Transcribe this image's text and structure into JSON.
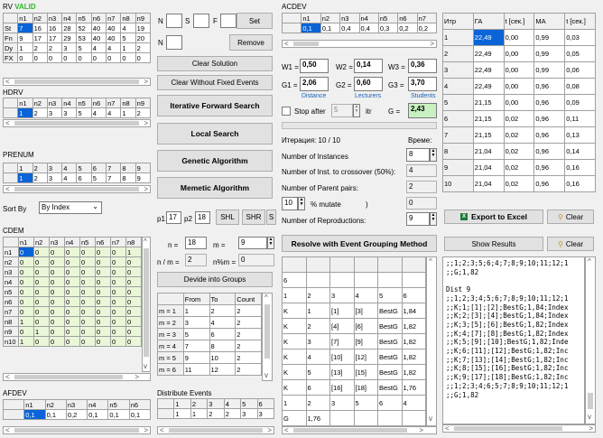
{
  "rv": {
    "title": "RV",
    "status": "VALID",
    "cols": [
      "",
      "n1",
      "n2",
      "n3",
      "n4",
      "n5",
      "n6",
      "n7",
      "n8",
      "n9"
    ],
    "rows": [
      [
        "St",
        "7",
        "16",
        "16",
        "28",
        "52",
        "40",
        "40",
        "4",
        "19"
      ],
      [
        "Fn",
        "9",
        "17",
        "17",
        "29",
        "53",
        "40",
        "40",
        "5",
        "20"
      ],
      [
        "Dy",
        "1",
        "2",
        "2",
        "3",
        "5",
        "4",
        "4",
        "1",
        "2"
      ],
      [
        "FX",
        "0",
        "0",
        "0",
        "0",
        "0",
        "0",
        "0",
        "0",
        "0"
      ]
    ]
  },
  "hdrv": {
    "title": "HDRV",
    "cols": [
      "",
      "n1",
      "n2",
      "n3",
      "n4",
      "n5",
      "n6",
      "n7",
      "n8",
      "n9"
    ],
    "row": [
      "",
      "1",
      "2",
      "3",
      "3",
      "5",
      "4",
      "4",
      "1",
      "2"
    ]
  },
  "prenum": {
    "title": "PRENUM",
    "r1": [
      "",
      "1",
      "2",
      "3",
      "4",
      "5",
      "6",
      "7",
      "8",
      "9"
    ],
    "r2": [
      "",
      "1",
      "2",
      "3",
      "4",
      "6",
      "5",
      "7",
      "8",
      "9"
    ]
  },
  "sort": {
    "label": "Sort By",
    "value": "By Index"
  },
  "cdem": {
    "title": "CDEM",
    "cols": [
      "",
      "n1",
      "n2",
      "n3",
      "n4",
      "n5",
      "n6",
      "n7",
      "n8"
    ],
    "rows": [
      [
        "n1",
        "0",
        "0",
        "0",
        "0",
        "0",
        "0",
        "0",
        "1"
      ],
      [
        "n2",
        "0",
        "0",
        "0",
        "0",
        "0",
        "0",
        "0",
        "0"
      ],
      [
        "n3",
        "0",
        "0",
        "0",
        "0",
        "0",
        "0",
        "0",
        "0"
      ],
      [
        "n4",
        "0",
        "0",
        "0",
        "0",
        "0",
        "0",
        "0",
        "0"
      ],
      [
        "n5",
        "0",
        "0",
        "0",
        "0",
        "0",
        "0",
        "0",
        "0"
      ],
      [
        "n6",
        "0",
        "0",
        "0",
        "0",
        "0",
        "0",
        "0",
        "0"
      ],
      [
        "n7",
        "0",
        "0",
        "0",
        "0",
        "0",
        "0",
        "0",
        "0"
      ],
      [
        "n8",
        "1",
        "0",
        "0",
        "0",
        "0",
        "0",
        "0",
        "0"
      ],
      [
        "n9",
        "0",
        "1",
        "0",
        "0",
        "0",
        "0",
        "0",
        "0"
      ],
      [
        "n10",
        "1",
        "0",
        "0",
        "0",
        "0",
        "0",
        "0",
        "0"
      ]
    ]
  },
  "afdev": {
    "title": "AFDEV",
    "cols": [
      "",
      "n1",
      "n2",
      "n3",
      "n4",
      "n5",
      "n6"
    ],
    "row": [
      "",
      "0,1",
      "0,1",
      "0,2",
      "0,1",
      "0,1",
      "0,1"
    ]
  },
  "nsf": {
    "n": "N",
    "s": "S",
    "f": "F",
    "set": "Set",
    "n2": "N",
    "remove": "Remove"
  },
  "buttons": {
    "clear_solution": "Clear Solution",
    "clear_wo_fixed": "Clear Without Fixed Events",
    "ifs": "Iterative Forward Search",
    "local": "Local Search",
    "ga": "Genetic Algorithm",
    "ma": "Memetic Algorithm"
  },
  "p": {
    "p1_label": "p1",
    "p1": "17",
    "p2_label": "p2",
    "p2": "18",
    "shl": "SHL",
    "shr": "SHR",
    "s": "S"
  },
  "groups": {
    "n_label": "n =",
    "n": "18",
    "m_label": "m =",
    "m": "9",
    "nm_label": "n / m =",
    "nm": "2",
    "nmod_label": "n%m =",
    "nmod": "0",
    "btn": "Devide into Groups",
    "cols": [
      "",
      "From",
      "To",
      "Count"
    ],
    "rows": [
      [
        "m = 1",
        "1",
        "2",
        "2"
      ],
      [
        "m = 2",
        "3",
        "4",
        "2"
      ],
      [
        "m = 3",
        "5",
        "6",
        "2"
      ],
      [
        "m = 4",
        "7",
        "8",
        "2"
      ],
      [
        "m = 5",
        "9",
        "10",
        "2"
      ],
      [
        "m = 6",
        "11",
        "12",
        "2"
      ]
    ]
  },
  "distribute": {
    "title": "Distribute Events",
    "r1": [
      "",
      "1",
      "2",
      "3",
      "4",
      "5",
      "6"
    ],
    "r2": [
      "",
      "1",
      "1",
      "2",
      "2",
      "3",
      "3"
    ]
  },
  "acdev": {
    "title": "ACDEV",
    "cols": [
      "",
      "n1",
      "n2",
      "n3",
      "n4",
      "n5",
      "n6",
      "n7"
    ],
    "row": [
      "",
      "0,1",
      "0,1",
      "0,4",
      "0,4",
      "0,3",
      "0,2",
      "0,2"
    ]
  },
  "weights": {
    "w1_label": "W1 =",
    "w1": "0,50",
    "w2_label": "W2 =",
    "w2": "0,14",
    "w3_label": "W3 =",
    "w3": "0,36",
    "g1_label": "G1 =",
    "g1": "2,06",
    "g2_label": "G2 =",
    "g2": "0,60",
    "g3_label": "G3 =",
    "g3": "3,70",
    "distance": "Distance",
    "lecturers": "Lecturers",
    "students": "Students"
  },
  "stop": {
    "label": "Stop after",
    "value": "5",
    "itr": "itr",
    "g_label": "G =",
    "g": "2,43"
  },
  "iter": {
    "label": "Итерация: 10 / 10",
    "time": "Време:"
  },
  "params": {
    "instances_label": "Number of Instances",
    "instances": "8",
    "crossover_label": "Number of Inst. to crossover (50%):",
    "crossover": "4",
    "parents_label": "Number of Parent pairs:",
    "parents": "2",
    "mutate_val": "10",
    "mutate_label": "% mutate",
    "paren": ")",
    "mutate_res": "0",
    "repro_label": "Number of Reproductions:",
    "repro": "9"
  },
  "resolve": {
    "btn": "Resolve with Event Grouping Method",
    "rows": [
      [
        "6",
        "",
        "",
        "",
        "",
        ""
      ],
      [
        "1",
        "2",
        "3",
        "4",
        "5",
        "6"
      ],
      [
        "K",
        "1",
        "[1]",
        "[3]",
        "BestG",
        "1,84"
      ],
      [
        "K",
        "2",
        "[4]",
        "[6]",
        "BestG",
        "1,82"
      ],
      [
        "K",
        "3",
        "[7]",
        "[9]",
        "BestG",
        "1,82"
      ],
      [
        "K",
        "4",
        "[10]",
        "[12]",
        "BestG",
        "1,82"
      ],
      [
        "K",
        "5",
        "[13]",
        "[15]",
        "BestG",
        "1,82"
      ],
      [
        "K",
        "6",
        "[16]",
        "[18]",
        "BestG",
        "1,76"
      ],
      [
        "1",
        "2",
        "3",
        "5",
        "6",
        "4"
      ],
      [
        "G",
        "1,76",
        "",
        "",
        "",
        ""
      ]
    ]
  },
  "results": {
    "cols": [
      "Итр",
      "ГА",
      "t [сек.]",
      "МА",
      "t [сек.]"
    ],
    "rows": [
      [
        "1",
        "22,49",
        "0,00",
        "0,99",
        "0,03"
      ],
      [
        "2",
        "22,49",
        "0,00",
        "0,99",
        "0,05"
      ],
      [
        "3",
        "22,49",
        "0,00",
        "0,99",
        "0,06"
      ],
      [
        "4",
        "22,49",
        "0,00",
        "0,96",
        "0,08"
      ],
      [
        "5",
        "21,15",
        "0,00",
        "0,96",
        "0,09"
      ],
      [
        "6",
        "21,15",
        "0,02",
        "0,96",
        "0,11"
      ],
      [
        "7",
        "21,15",
        "0,02",
        "0,96",
        "0,13"
      ],
      [
        "8",
        "21,04",
        "0,02",
        "0,96",
        "0,14"
      ],
      [
        "9",
        "21,04",
        "0,02",
        "0,96",
        "0,16"
      ],
      [
        "10",
        "21,04",
        "0,02",
        "0,96",
        "0,16"
      ]
    ],
    "export": "Export to Excel",
    "clear": "Clear",
    "show": "Show Results",
    "clear2": "Clear"
  },
  "log": {
    "text": ";;1;2;3;5;6;4;7;8;9;10;11;12;1\n;;G;1,82\n\nDist 9\n;;1;2;3;4;5;6;7;8;9;10;11;12;1\n;;K;1;[1];[2];BestG;1,84;Index\n;;K;2;[3];[4];BestG;1,84;Index\n;;K;3;[5];[6];BestG;1,82;Index\n;;K;4;[7];[8];BestG;1,82;Index\n;;K;5;[9];[10];BestG;1,82;Inde\n;;K;6;[11];[12];BestG;1,82;Inc\n;;K;7;[13];[14];BestG;1,82;Inc\n;;K;8;[15];[16];BestG;1,82;Inc\n;;K;9;[17];[18];BestG;1,82;Inc\n;;1;2;3;4;6;5;7;8;9;10;11;12;1\n;;G;1,82"
  },
  "colors": {
    "selection": "#0a64d8",
    "valid": "#2db82d",
    "distance": "#1a5fb4",
    "g_bg": "#c8f0c0"
  }
}
